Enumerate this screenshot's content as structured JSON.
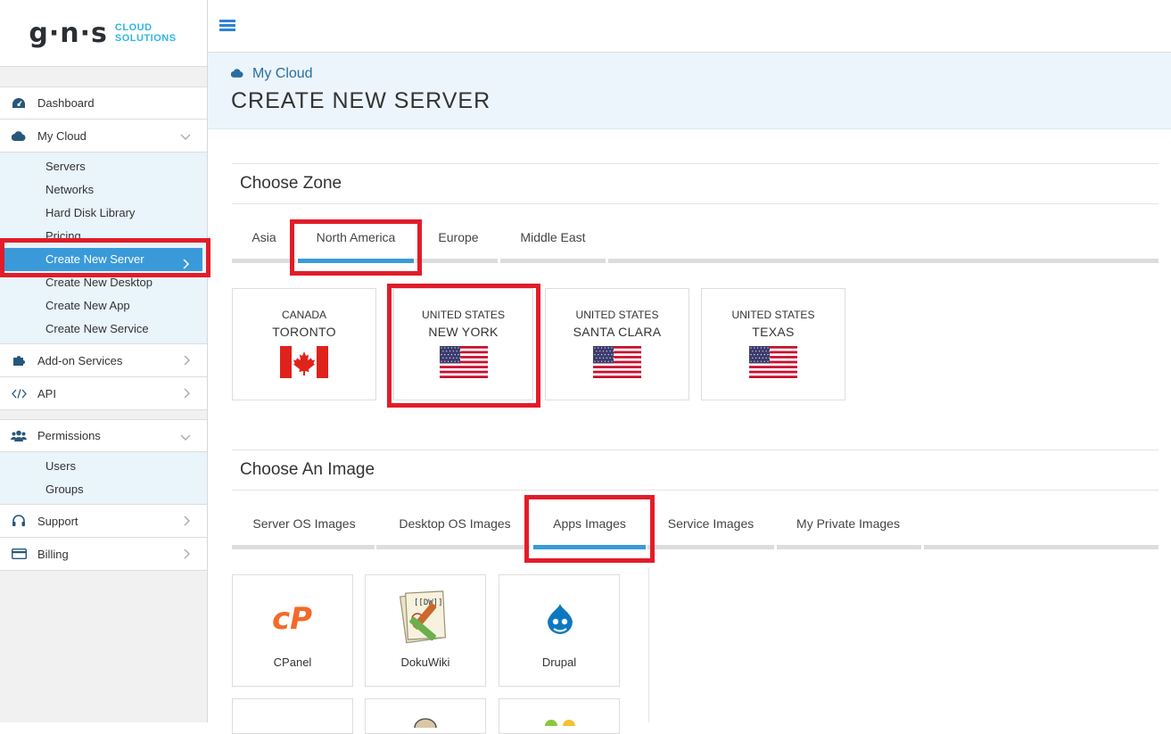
{
  "brand": {
    "mark": "g·n·s",
    "line1": "CLOUD",
    "line2": "SOLUTIONS"
  },
  "sidebar": {
    "items": [
      {
        "label": "Dashboard"
      },
      {
        "label": "My Cloud"
      },
      {
        "label": "Add-on Services"
      },
      {
        "label": "API"
      },
      {
        "label": "Permissions"
      },
      {
        "label": "Support"
      },
      {
        "label": "Billing"
      }
    ],
    "my_cloud_sub": [
      "Servers",
      "Networks",
      "Hard Disk Library",
      "Pricing",
      "Create New Server",
      "Create New Desktop",
      "Create New App",
      "Create New Service"
    ],
    "permissions_sub": [
      "Users",
      "Groups"
    ]
  },
  "header": {
    "breadcrumb": "My Cloud",
    "title": "CREATE NEW SERVER"
  },
  "zone": {
    "title": "Choose Zone",
    "tabs": [
      "Asia",
      "North America",
      "Europe",
      "Middle East"
    ],
    "active_tab": "North America",
    "cards": [
      {
        "country": "CANADA",
        "city": "TORONTO",
        "flag": "canada-flag"
      },
      {
        "country": "UNITED STATES",
        "city": "NEW YORK",
        "flag": "us-flag"
      },
      {
        "country": "UNITED STATES",
        "city": "SANTA CLARA",
        "flag": "us-flag"
      },
      {
        "country": "UNITED STATES",
        "city": "TEXAS",
        "flag": "us-flag"
      }
    ],
    "selected_card": "NEW YORK"
  },
  "image": {
    "title": "Choose An Image",
    "tabs": [
      "Server OS Images",
      "Desktop OS Images",
      "Apps Images",
      "Service Images",
      "My Private Images"
    ],
    "active_tab": "Apps Images",
    "apps": [
      {
        "name": "CPanel",
        "logo": "cpanel-logo"
      },
      {
        "name": "DokuWiki",
        "logo": "dokuwiki-logo"
      },
      {
        "name": "Drupal",
        "logo": "drupal-logo"
      }
    ]
  },
  "colors": {
    "accent": "#3a9ad9",
    "highlight": "#e21c2a",
    "cpanel": "#f26b2a",
    "drupal": "#0d78c2"
  }
}
